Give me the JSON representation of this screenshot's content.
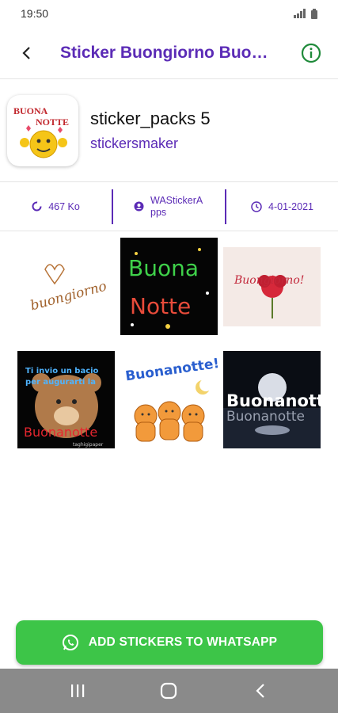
{
  "status_bar": {
    "time": "19:50",
    "signal_icon": "signal-icon",
    "battery_icon": "battery-icon"
  },
  "toolbar": {
    "title": "Sticker Buongiorno Buo…",
    "back_icon": "back-arrow-icon",
    "info_icon": "info-icon"
  },
  "pack": {
    "tray_text_1": "BUONA",
    "tray_text_2": "NOTTE",
    "name": "sticker_packs 5",
    "author": "stickersmaker"
  },
  "meta": {
    "size": "467 Ko",
    "publisher": "WAStickerApps",
    "date": "4-01-2021"
  },
  "stickers": [
    {
      "text": "buongiorno"
    },
    {
      "text_1": "Buona",
      "text_2": "Notte"
    },
    {
      "text": "Buongiorno!"
    },
    {
      "text_1": "Ti invio un bacio",
      "text_2": "per augurarti la",
      "text_3": "Buonanotte",
      "text_4": "taghigipaper"
    },
    {
      "text": "Buonanotte!"
    },
    {
      "text_1": "Buonanotte..",
      "text_2": "Buonanotte"
    }
  ],
  "add_button": {
    "label": "ADD STICKERS TO WHATSAPP"
  },
  "colors": {
    "accent": "#5b2bb6",
    "add_button": "#3dc548",
    "nav_bar": "#8a8a8a"
  }
}
